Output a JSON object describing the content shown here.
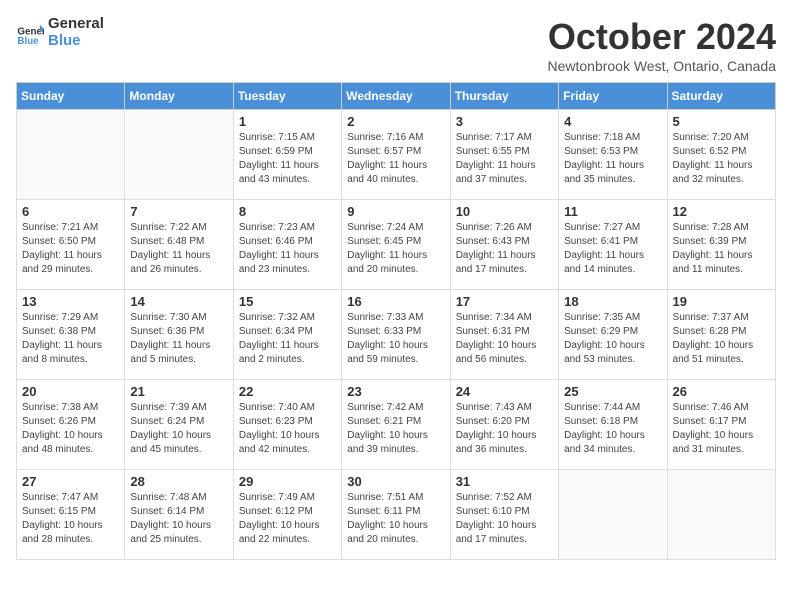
{
  "header": {
    "logo_general": "General",
    "logo_blue": "Blue",
    "month": "October 2024",
    "location": "Newtonbrook West, Ontario, Canada"
  },
  "days_of_week": [
    "Sunday",
    "Monday",
    "Tuesday",
    "Wednesday",
    "Thursday",
    "Friday",
    "Saturday"
  ],
  "weeks": [
    [
      {
        "day": "",
        "info": ""
      },
      {
        "day": "",
        "info": ""
      },
      {
        "day": "1",
        "info": "Sunrise: 7:15 AM\nSunset: 6:59 PM\nDaylight: 11 hours and 43 minutes."
      },
      {
        "day": "2",
        "info": "Sunrise: 7:16 AM\nSunset: 6:57 PM\nDaylight: 11 hours and 40 minutes."
      },
      {
        "day": "3",
        "info": "Sunrise: 7:17 AM\nSunset: 6:55 PM\nDaylight: 11 hours and 37 minutes."
      },
      {
        "day": "4",
        "info": "Sunrise: 7:18 AM\nSunset: 6:53 PM\nDaylight: 11 hours and 35 minutes."
      },
      {
        "day": "5",
        "info": "Sunrise: 7:20 AM\nSunset: 6:52 PM\nDaylight: 11 hours and 32 minutes."
      }
    ],
    [
      {
        "day": "6",
        "info": "Sunrise: 7:21 AM\nSunset: 6:50 PM\nDaylight: 11 hours and 29 minutes."
      },
      {
        "day": "7",
        "info": "Sunrise: 7:22 AM\nSunset: 6:48 PM\nDaylight: 11 hours and 26 minutes."
      },
      {
        "day": "8",
        "info": "Sunrise: 7:23 AM\nSunset: 6:46 PM\nDaylight: 11 hours and 23 minutes."
      },
      {
        "day": "9",
        "info": "Sunrise: 7:24 AM\nSunset: 6:45 PM\nDaylight: 11 hours and 20 minutes."
      },
      {
        "day": "10",
        "info": "Sunrise: 7:26 AM\nSunset: 6:43 PM\nDaylight: 11 hours and 17 minutes."
      },
      {
        "day": "11",
        "info": "Sunrise: 7:27 AM\nSunset: 6:41 PM\nDaylight: 11 hours and 14 minutes."
      },
      {
        "day": "12",
        "info": "Sunrise: 7:28 AM\nSunset: 6:39 PM\nDaylight: 11 hours and 11 minutes."
      }
    ],
    [
      {
        "day": "13",
        "info": "Sunrise: 7:29 AM\nSunset: 6:38 PM\nDaylight: 11 hours and 8 minutes."
      },
      {
        "day": "14",
        "info": "Sunrise: 7:30 AM\nSunset: 6:36 PM\nDaylight: 11 hours and 5 minutes."
      },
      {
        "day": "15",
        "info": "Sunrise: 7:32 AM\nSunset: 6:34 PM\nDaylight: 11 hours and 2 minutes."
      },
      {
        "day": "16",
        "info": "Sunrise: 7:33 AM\nSunset: 6:33 PM\nDaylight: 10 hours and 59 minutes."
      },
      {
        "day": "17",
        "info": "Sunrise: 7:34 AM\nSunset: 6:31 PM\nDaylight: 10 hours and 56 minutes."
      },
      {
        "day": "18",
        "info": "Sunrise: 7:35 AM\nSunset: 6:29 PM\nDaylight: 10 hours and 53 minutes."
      },
      {
        "day": "19",
        "info": "Sunrise: 7:37 AM\nSunset: 6:28 PM\nDaylight: 10 hours and 51 minutes."
      }
    ],
    [
      {
        "day": "20",
        "info": "Sunrise: 7:38 AM\nSunset: 6:26 PM\nDaylight: 10 hours and 48 minutes."
      },
      {
        "day": "21",
        "info": "Sunrise: 7:39 AM\nSunset: 6:24 PM\nDaylight: 10 hours and 45 minutes."
      },
      {
        "day": "22",
        "info": "Sunrise: 7:40 AM\nSunset: 6:23 PM\nDaylight: 10 hours and 42 minutes."
      },
      {
        "day": "23",
        "info": "Sunrise: 7:42 AM\nSunset: 6:21 PM\nDaylight: 10 hours and 39 minutes."
      },
      {
        "day": "24",
        "info": "Sunrise: 7:43 AM\nSunset: 6:20 PM\nDaylight: 10 hours and 36 minutes."
      },
      {
        "day": "25",
        "info": "Sunrise: 7:44 AM\nSunset: 6:18 PM\nDaylight: 10 hours and 34 minutes."
      },
      {
        "day": "26",
        "info": "Sunrise: 7:46 AM\nSunset: 6:17 PM\nDaylight: 10 hours and 31 minutes."
      }
    ],
    [
      {
        "day": "27",
        "info": "Sunrise: 7:47 AM\nSunset: 6:15 PM\nDaylight: 10 hours and 28 minutes."
      },
      {
        "day": "28",
        "info": "Sunrise: 7:48 AM\nSunset: 6:14 PM\nDaylight: 10 hours and 25 minutes."
      },
      {
        "day": "29",
        "info": "Sunrise: 7:49 AM\nSunset: 6:12 PM\nDaylight: 10 hours and 22 minutes."
      },
      {
        "day": "30",
        "info": "Sunrise: 7:51 AM\nSunset: 6:11 PM\nDaylight: 10 hours and 20 minutes."
      },
      {
        "day": "31",
        "info": "Sunrise: 7:52 AM\nSunset: 6:10 PM\nDaylight: 10 hours and 17 minutes."
      },
      {
        "day": "",
        "info": ""
      },
      {
        "day": "",
        "info": ""
      }
    ]
  ]
}
